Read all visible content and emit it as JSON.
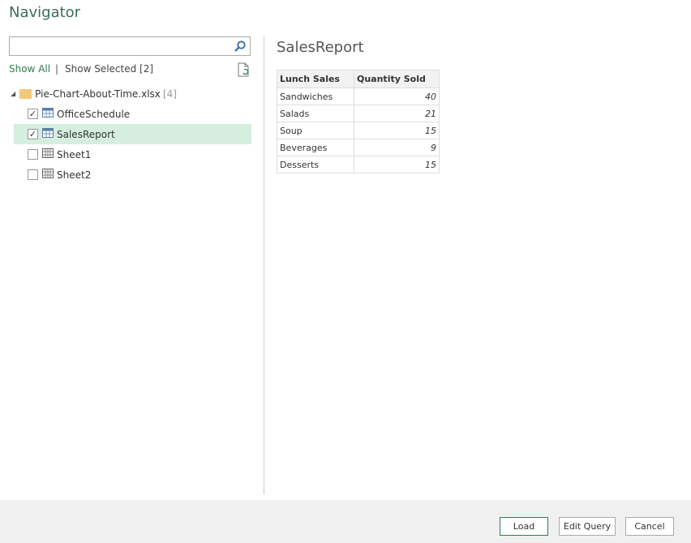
{
  "window": {
    "title": "Navigator"
  },
  "search": {
    "value": "",
    "placeholder": ""
  },
  "filters": {
    "show_all": "Show All",
    "separator": "|",
    "show_selected": "Show Selected [2]"
  },
  "tree": {
    "root": {
      "label": "Pie-Chart-About-Time.xlsx",
      "count": "[4]"
    },
    "items": [
      {
        "label": "OfficeSchedule",
        "checked": true,
        "type": "table"
      },
      {
        "label": "SalesReport",
        "checked": true,
        "type": "table",
        "selected": true
      },
      {
        "label": "Sheet1",
        "checked": false,
        "type": "sheet"
      },
      {
        "label": "Sheet2",
        "checked": false,
        "type": "sheet"
      }
    ]
  },
  "preview": {
    "title": "SalesReport",
    "columns": [
      "Lunch Sales",
      "Quantity Sold"
    ],
    "rows": [
      [
        "Sandwiches",
        "40"
      ],
      [
        "Salads",
        "21"
      ],
      [
        "Soup",
        "15"
      ],
      [
        "Beverages",
        "9"
      ],
      [
        "Desserts",
        "15"
      ]
    ]
  },
  "buttons": {
    "load": "Load",
    "edit_query": "Edit Query",
    "cancel": "Cancel"
  },
  "colors": {
    "accent": "#2e7d4f",
    "selected_row": "#d5eedf",
    "footer": "#f0f0f0"
  }
}
